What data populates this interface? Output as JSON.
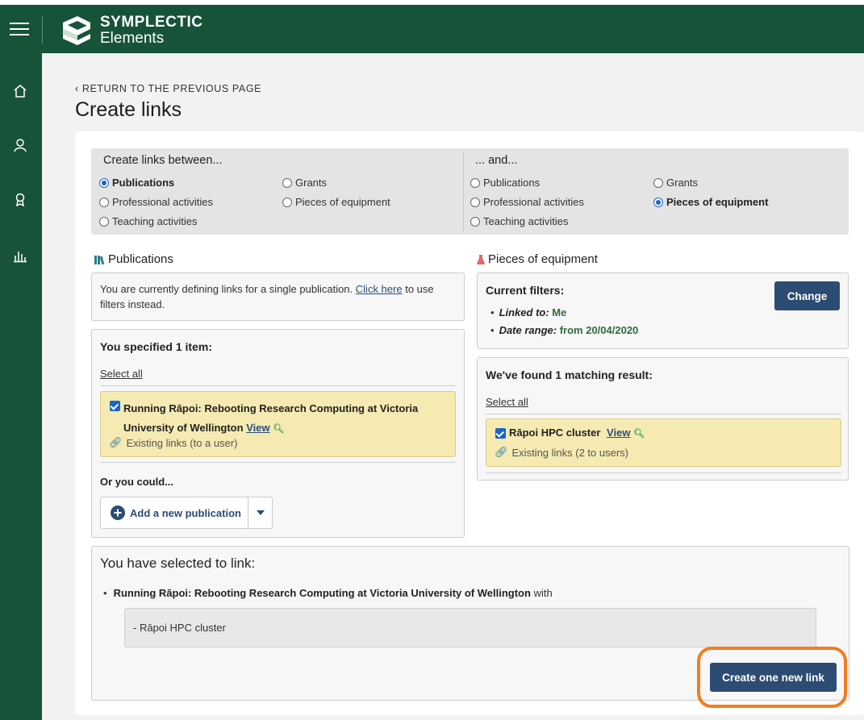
{
  "app": {
    "brand_line1": "SYMPLECTIC",
    "brand_line2": "Elements"
  },
  "sidebar": {
    "items": [
      "home-icon",
      "user-icon",
      "award-icon",
      "bar-chart-icon"
    ]
  },
  "page": {
    "return_link": "RETURN TO THE PREVIOUS PAGE",
    "title": "Create links"
  },
  "link_types": {
    "between_heading": "Create links between...",
    "and_heading": "... and...",
    "left_options": [
      "Publications",
      "Grants",
      "Professional activities",
      "Pieces of equipment",
      "Teaching activities"
    ],
    "left_selected": "Publications",
    "right_options": [
      "Publications",
      "Grants",
      "Professional activities",
      "Pieces of equipment",
      "Teaching activities"
    ],
    "right_selected": "Pieces of equipment"
  },
  "left_panel": {
    "title": "Publications",
    "info_text_before": "You are currently defining links for a single publication.",
    "info_link": "Click here",
    "info_text_after": "to use",
    "info_text_line2": "filters instead.",
    "specified_heading": "You specified 1 item:",
    "select_all": "Select all",
    "item_title_line1": "Running Rāpoi: Rebooting Research Computing at Victoria",
    "item_title_line2": "University of Wellington",
    "item_view": "View",
    "item_existing": "Existing links (to a user)",
    "or_you_could": "Or you could...",
    "add_button": "Add a new publication"
  },
  "right_panel": {
    "title": "Pieces of equipment",
    "filters_heading": "Current filters:",
    "filter1_label": "Linked to:",
    "filter1_value": "Me",
    "filter2_label": "Date range:",
    "filter2_value": "from 20/04/2020",
    "change_button": "Change",
    "found_heading": "We've found 1 matching result:",
    "select_all": "Select all",
    "item_title": "Rāpoi HPC cluster",
    "item_view": "View",
    "item_existing": "Existing links (2 to users)"
  },
  "summary": {
    "heading": "You have selected to link:",
    "source_title": "Running Rāpoi: Rebooting Research Computing at Victoria University of Wellington",
    "with_word": "with",
    "target_line": "- Rāpoi HPC cluster",
    "create_button": "Create one new link"
  },
  "colors": {
    "brand_green": "#175339",
    "button_navy": "#2d4c73",
    "highlight_orange": "#f07e21",
    "selected_item_bg": "#f5eab1"
  }
}
